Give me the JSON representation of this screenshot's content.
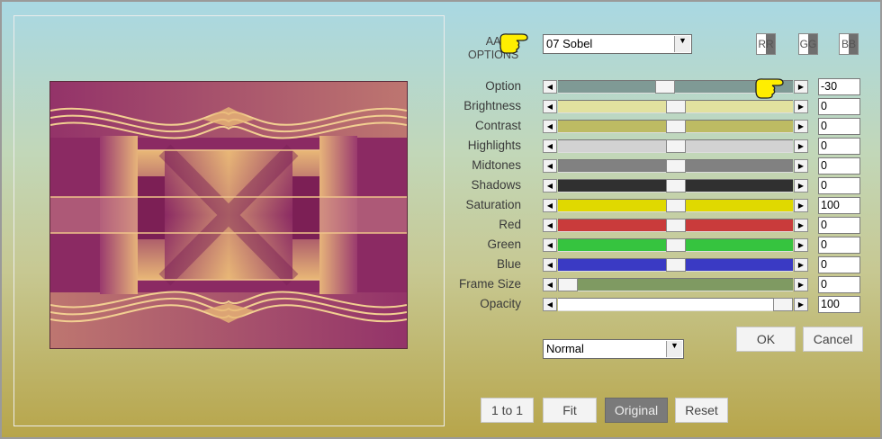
{
  "header": {
    "label_line1": "AA",
    "label_line2": "OPTIONS",
    "filter_select": "07  Sobel",
    "channel_toggles": [
      "RR",
      "GG",
      "BB"
    ]
  },
  "sliders": [
    {
      "key": "option",
      "label": "Option",
      "value": "-30",
      "level": 0.45,
      "color": "#7f9a95",
      "thumb_label": ""
    },
    {
      "key": "brightness",
      "label": "Brightness",
      "value": "0",
      "level": 0.5,
      "color": "#e2e19f"
    },
    {
      "key": "contrast",
      "label": "Contrast",
      "value": "0",
      "level": 0.5,
      "color": "#bdbb63"
    },
    {
      "key": "highlights",
      "label": "Highlights",
      "value": "0",
      "level": 0.5,
      "color": "#d2d2d2"
    },
    {
      "key": "midtones",
      "label": "Midtones",
      "value": "0",
      "level": 0.5,
      "color": "#818181"
    },
    {
      "key": "shadows",
      "label": "Shadows",
      "value": "0",
      "level": 0.5,
      "color": "#303030"
    },
    {
      "key": "saturation",
      "label": "Saturation",
      "value": "100",
      "level": 0.5,
      "color": "#e0d900"
    },
    {
      "key": "red",
      "label": "Red",
      "value": "0",
      "level": 0.5,
      "color": "#c93b3b"
    },
    {
      "key": "green",
      "label": "Green",
      "value": "0",
      "level": 0.5,
      "color": "#36c43f"
    },
    {
      "key": "blue",
      "label": "Blue",
      "value": "0",
      "level": 0.5,
      "color": "#3a3ac4"
    },
    {
      "key": "frame_size",
      "label": "Frame Size",
      "value": "0",
      "level": 0.0,
      "color": "#7f9a62"
    },
    {
      "key": "opacity",
      "label": "Opacity",
      "value": "100",
      "level": 1.0,
      "color": "#ffffff"
    }
  ],
  "blend_mode": "Normal",
  "buttons": {
    "ok": "OK",
    "cancel": "Cancel",
    "one_to_one": "1 to 1",
    "fit": "Fit",
    "original": "Original",
    "reset": "Reset"
  },
  "colors": {
    "preview_purple": "#8b2a63",
    "preview_gold": "#e9b877",
    "original_button_bg": "#7a7a7a"
  }
}
